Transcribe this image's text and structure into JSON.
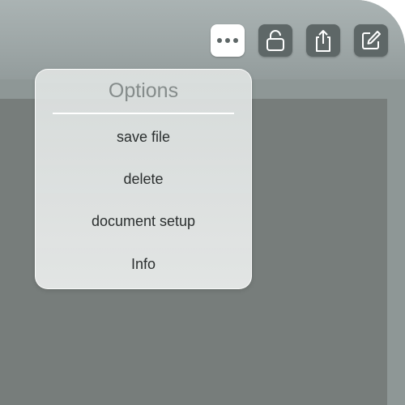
{
  "toolbar": {
    "buttons": [
      {
        "icon": "more-dots-icon",
        "state": "active"
      },
      {
        "icon": "unlock-icon"
      },
      {
        "icon": "share-icon"
      },
      {
        "icon": "edit-icon"
      }
    ]
  },
  "menu": {
    "title": "Options",
    "items": [
      {
        "label": "save file"
      },
      {
        "label": "delete"
      },
      {
        "label": "document setup"
      },
      {
        "label": "Info"
      }
    ]
  },
  "colors": {
    "toolbar_bg": "#9da6a6",
    "document_bg": "#777d7b",
    "button_bg": "#5e6767",
    "active_button_bg": "#ffffff",
    "menu_bg": "#e2e5e4"
  }
}
